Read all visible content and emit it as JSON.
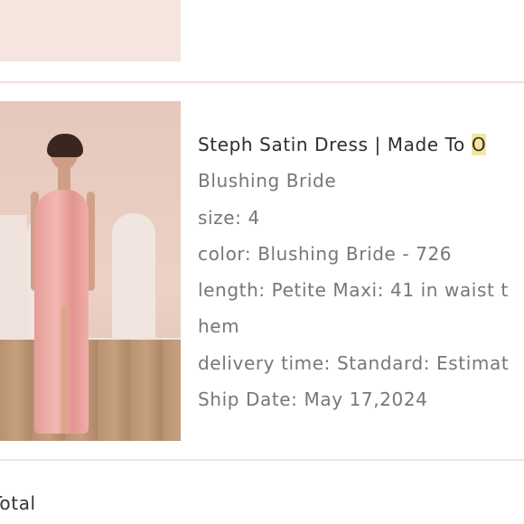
{
  "product": {
    "title_main": "Steph Satin Dress | Made To ",
    "title_highlight": "O",
    "subtitle": "Blushing Bride",
    "size": "size: 4",
    "color": "color: Blushing Bride - 726",
    "length_line1": "length: Petite Maxi: 41 in waist t",
    "length_line2": "hem",
    "delivery": "delivery time: Standard: Estimat",
    "ship_date": "Ship Date: May 17,2024"
  },
  "footer": {
    "total_label": "Total"
  },
  "colors": {
    "background": "#ffffff",
    "divider": "#f3e1da",
    "image_placeholder": "#f6e4df",
    "highlight": "#f6e59e",
    "muted_text": "#777777"
  }
}
